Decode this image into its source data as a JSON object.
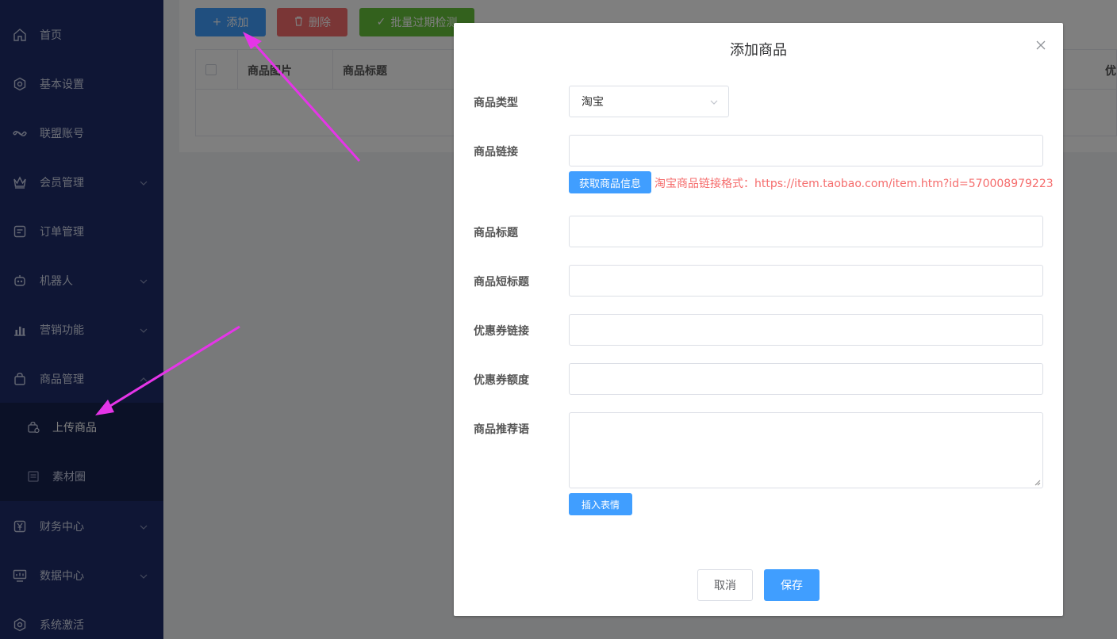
{
  "sidebar": {
    "items": [
      {
        "label": "首页",
        "icon": "home-icon"
      },
      {
        "label": "基本设置",
        "icon": "hexagon-icon"
      },
      {
        "label": "联盟账号",
        "icon": "handshake-icon"
      },
      {
        "label": "会员管理",
        "icon": "crown-icon"
      },
      {
        "label": "订单管理",
        "icon": "order-icon"
      },
      {
        "label": "机器人",
        "icon": "robot-icon"
      },
      {
        "label": "营销功能",
        "icon": "chart-icon"
      },
      {
        "label": "商品管理",
        "icon": "bag-icon"
      },
      {
        "label": "财务中心",
        "icon": "yen-icon"
      },
      {
        "label": "数据中心",
        "icon": "monitor-icon"
      },
      {
        "label": "系统激活",
        "icon": "hexagon-icon"
      }
    ],
    "sub_items": [
      {
        "label": "上传商品",
        "icon": "upload-bag-icon"
      },
      {
        "label": "素材圈",
        "icon": "file-icon"
      }
    ]
  },
  "toolbar": {
    "add_label": "添加",
    "delete_label": "删除",
    "check_label": "批量过期检测"
  },
  "table": {
    "columns": [
      "商品图片",
      "商品标题",
      "优"
    ]
  },
  "dialog": {
    "title": "添加商品",
    "fields": {
      "type_label": "商品类型",
      "type_value": "淘宝",
      "link_label": "商品链接",
      "fetch_button": "获取商品信息",
      "link_hint": "淘宝商品链接格式：https://item.taobao.com/item.htm?id=570008979223",
      "title_label": "商品标题",
      "short_title_label": "商品短标题",
      "coupon_link_label": "优惠券链接",
      "coupon_amount_label": "优惠券额度",
      "recommend_label": "商品推荐语",
      "emoji_button": "插入表情"
    },
    "cancel_label": "取消",
    "save_label": "保存"
  },
  "colors": {
    "sidebar_bg": "#1f2d6b",
    "primary": "#409eff",
    "danger": "#f56c6c",
    "success": "#67c23a",
    "annotation": "#e535e8"
  }
}
